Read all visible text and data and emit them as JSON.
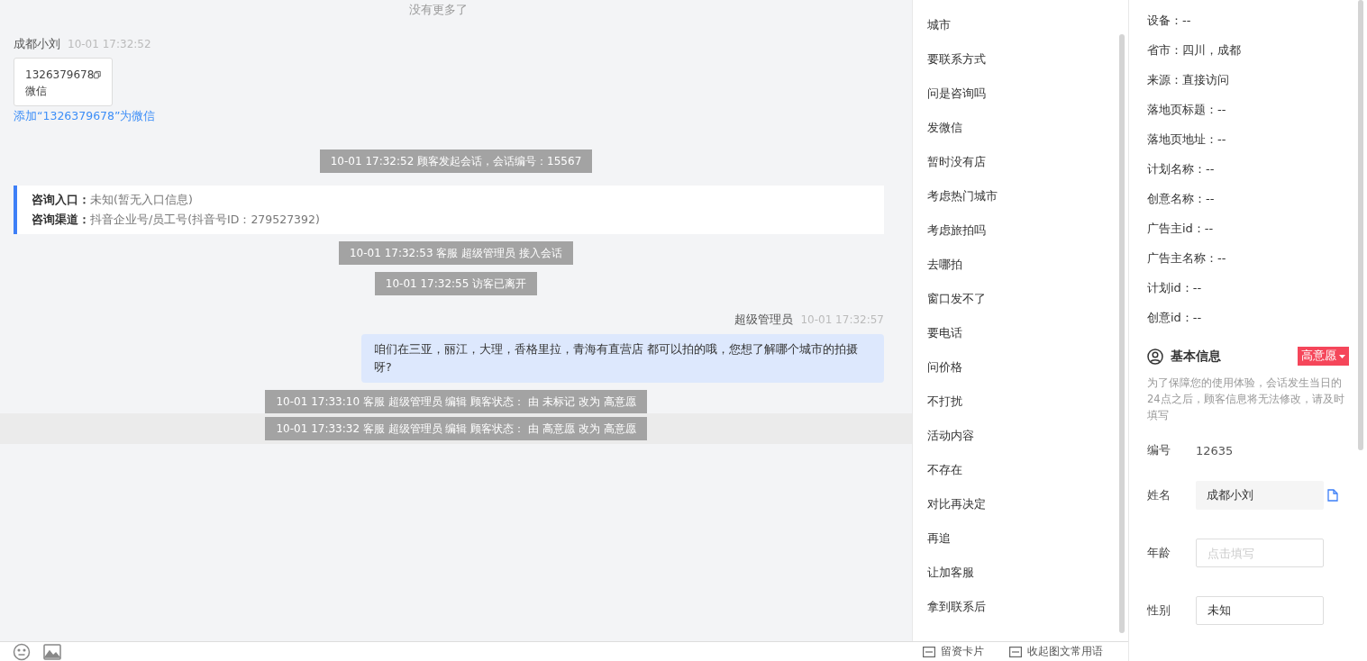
{
  "chat": {
    "no_more": "没有更多了",
    "messages": [
      {
        "kind": "contact_card",
        "sender": "成都小刘",
        "time": "10-01 17:32:52",
        "card_value": "1326379678",
        "card_type": "微信",
        "link": "添加“1326379678”为微信"
      },
      {
        "kind": "system",
        "text": "10-01 17:32:52 顾客发起会话，会话编号：15567",
        "highlighted": false
      },
      {
        "kind": "info_card",
        "lines": [
          {
            "label": "咨询入口：",
            "value": "未知(暂无入口信息)"
          },
          {
            "label": "咨询渠道：",
            "value": "抖音企业号/员工号(抖音号ID：279527392)"
          }
        ]
      },
      {
        "kind": "system",
        "text": "10-01 17:32:53 客服 超级管理员 接入会话",
        "highlighted": false
      },
      {
        "kind": "system",
        "text": "10-01 17:32:55 访客已离开",
        "highlighted": false
      },
      {
        "kind": "outgoing",
        "sender": "超级管理员",
        "time": "10-01 17:32:57",
        "text": "咱们在三亚，丽江，大理，香格里拉，青海有直营店 都可以拍的哦，您想了解哪个城市的拍摄呀?"
      },
      {
        "kind": "system",
        "text": "10-01 17:33:10 客服 超级管理员 编辑 顾客状态： 由 未标记 改为 高意愿",
        "highlighted": false
      },
      {
        "kind": "system",
        "text": "10-01 17:33:32 客服 超级管理员 编辑 顾客状态： 由 高意愿 改为 高意愿",
        "highlighted": true
      }
    ]
  },
  "toolbar": {
    "buttons": [
      "留资卡片",
      "收起图文常用语"
    ]
  },
  "quick_replies": [
    "城市",
    "要联系方式",
    "问是咨询吗",
    "发微信",
    "暂时没有店",
    "考虑热门城市",
    "考虑旅拍吗",
    "去哪拍",
    "窗口发不了",
    "要电话",
    "问价格",
    "不打扰",
    "活动内容",
    "不存在",
    "对比再决定",
    "再追",
    "让加客服",
    "拿到联系后"
  ],
  "visitor_info": [
    "设备：--",
    "省市：四川，成都",
    "来源：直接访问",
    "落地页标题：--",
    "落地页地址：--",
    "计划名称：--",
    "创意名称：--",
    "广告主id：--",
    "广告主名称：--",
    "计划id：--",
    "创意id：--"
  ],
  "basic_info": {
    "title": "基本信息",
    "intent": "高意愿",
    "notice": "为了保障您的使用体验，会话发生当日的24点之后，顾客信息将无法修改，请及时填写",
    "fields": [
      {
        "kind": "text",
        "label": "编号",
        "value": "12635"
      },
      {
        "kind": "copy",
        "label": "姓名",
        "value": "成都小刘"
      },
      {
        "kind": "input",
        "label": "年龄",
        "placeholder": "点击填写"
      },
      {
        "kind": "input",
        "label": "性别",
        "value": "未知"
      }
    ]
  }
}
